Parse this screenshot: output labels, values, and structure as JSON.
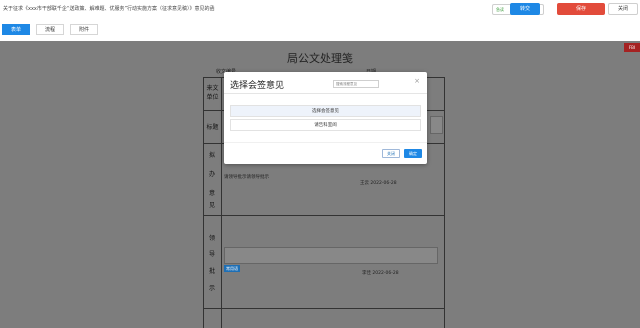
{
  "header": {
    "doc_title": "关于征求《xxx市干部联千企“送政策、解难题、优服务”行动实施方案（征求意见稿）》意见的函",
    "status_select": {
      "value": "急读",
      "color": "#3a9a3a"
    },
    "transfer_label": "转交",
    "save_label": "保存",
    "close_label": "关闭"
  },
  "tabs": [
    {
      "label": "表单",
      "active": true
    },
    {
      "label": "流程",
      "active": false
    },
    {
      "label": "附件",
      "active": false
    }
  ],
  "flag_label": "FBI",
  "form": {
    "title": "局公文处理笺",
    "receive_label": "收文编号",
    "date_label": "日期",
    "unit_label": "来文单位",
    "subject_label": "标题",
    "opinion_chars": [
      "拟",
      "办",
      "意",
      "见"
    ],
    "leader_chars": [
      "领",
      "导",
      "批",
      "示"
    ],
    "opinion_text": "请领导批示请领导批示",
    "opinion_signer": "王云  2022-06-28",
    "leader_tag": "常用语",
    "leader_signer": "李佳      2022-06-28"
  },
  "modal": {
    "title": "选择会签意见",
    "search_placeholder": "搜索流程意见",
    "close_icon": "×",
    "options": [
      "选择会签意见",
      "请告科室阅"
    ],
    "cancel_label": "关闭",
    "ok_label": "确定"
  },
  "colors": {
    "accent": "#1e88e5",
    "save": "#e24b3b",
    "overlay": "#7d7d7d"
  }
}
